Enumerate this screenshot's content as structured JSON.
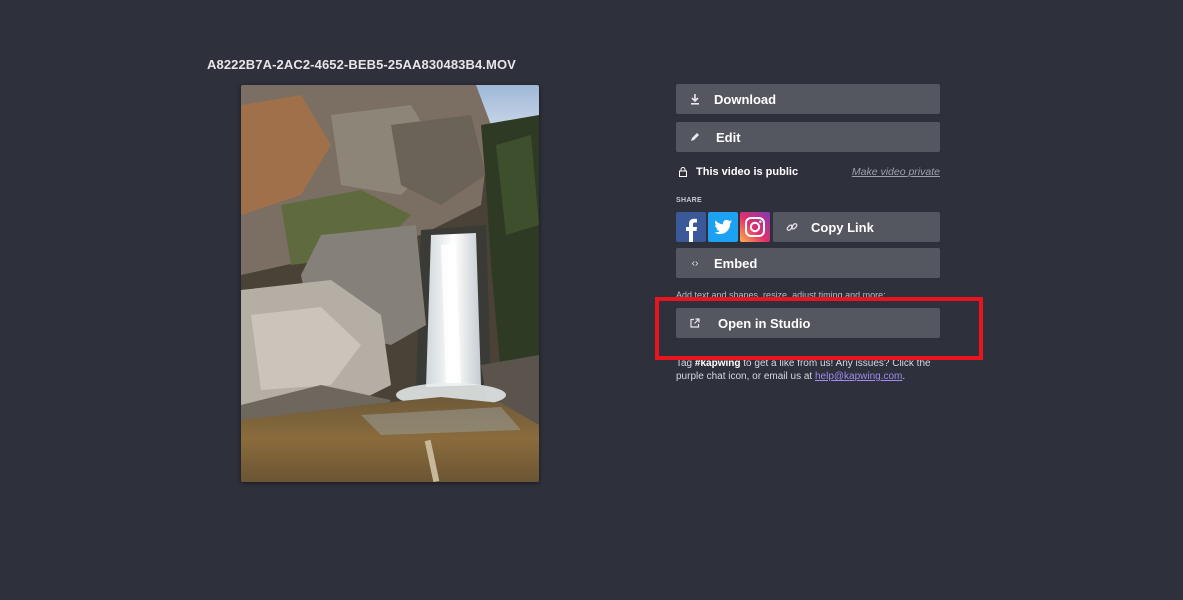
{
  "video": {
    "filename": "A8222B7A-2AC2-4652-BEB5-25AA830483B4.MOV",
    "preview_subject": "waterfall-over-rocks"
  },
  "actions": {
    "download_label": "Download",
    "edit_label": "Edit",
    "copy_link_label": "Copy Link",
    "embed_label": "Embed",
    "open_studio_label": "Open in Studio"
  },
  "privacy": {
    "status": "This video is public",
    "toggle_label": "Make video private"
  },
  "share": {
    "heading": "SHARE",
    "networks": [
      "facebook-icon",
      "twitter-icon",
      "instagram-icon"
    ]
  },
  "studio_hint": "Add text and shapes, resize, adjust timing and more:",
  "footer": {
    "prefix": "Tag ",
    "hashtag": "#kapwing",
    "middle": " to get a like from us! Any issues? Click the purple chat icon, or email us at ",
    "email": "help@kapwing.com",
    "suffix": "."
  },
  "colors": {
    "background": "#2e303b",
    "button": "#545660",
    "highlight": "#e8141e",
    "link": "#9c8cf0",
    "facebook": "#3b5998",
    "twitter": "#1da1f2"
  }
}
